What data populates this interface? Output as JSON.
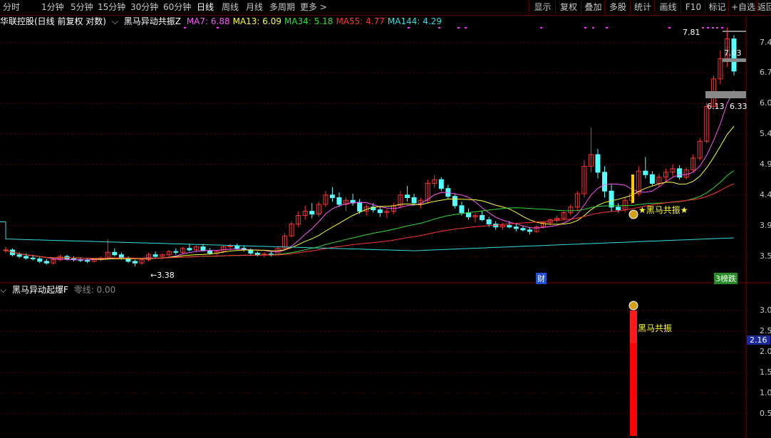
{
  "toolbar": {
    "periods": [
      "分时",
      "1分钟",
      "5分钟",
      "15分钟",
      "30分钟",
      "60分钟",
      "日线",
      "周线",
      "月线",
      "多周期",
      "更多"
    ],
    "active_period": "日线",
    "buttons": [
      "显示",
      "复权",
      "叠加",
      "多股",
      "统计",
      "画线",
      "F10",
      "标记",
      "+自选",
      "返回"
    ]
  },
  "upper_legend": {
    "stock": "华联控股(日线 前复权 对数)",
    "indicator": "黑马异动共振Z",
    "mas": [
      {
        "label": "MA7: 6.88",
        "color": "#ff55ff"
      },
      {
        "label": "MA13: 6.09",
        "color": "#ffff33"
      },
      {
        "label": "MA34: 5.18",
        "color": "#33dd33"
      },
      {
        "label": "MA55: 4.77",
        "color": "#ff3333"
      },
      {
        "label": "MA144: 4.29",
        "color": "#33dddd"
      }
    ]
  },
  "lower_legend": {
    "indicator": "黑马异动起爆F",
    "zero_line": "零线: 0.00"
  },
  "annotations": {
    "high": "7.81",
    "low": "←3.38",
    "price_7_03": "7.03",
    "price_6_13": "6.13",
    "price_6_33": "6.33",
    "signal_upper": "★黑马共振★",
    "signal_lower": "黑马共振",
    "cai": "财",
    "tag_right": "3榜跌"
  },
  "upper_axis": [
    "7.4",
    "6.7",
    "6.0",
    "5.4",
    "4.9",
    "4.4",
    "3.9",
    "3.5"
  ],
  "lower_axis": [
    "3.0",
    "2.5",
    "2.0",
    "1.5",
    "1.0",
    "0.5"
  ],
  "lower_value_tag": "2.16",
  "colors": {
    "up": "#ff3232",
    "down": "#54ffff",
    "grid": "#5a0000",
    "ma7": "#ff55ff",
    "ma13": "#ffff33",
    "ma34": "#33dd33",
    "ma55": "#ff3333",
    "ma144": "#33dddd"
  },
  "chart_data": {
    "type": "candlestick",
    "scale": "log",
    "y_ticks": [
      7.4,
      6.7,
      6.0,
      5.4,
      4.9,
      4.4,
      3.9,
      3.5
    ],
    "ohlc": [
      [
        3.58,
        3.62,
        3.54,
        3.58
      ],
      [
        3.58,
        3.6,
        3.5,
        3.52
      ],
      [
        3.52,
        3.55,
        3.48,
        3.5
      ],
      [
        3.5,
        3.54,
        3.46,
        3.48
      ],
      [
        3.48,
        3.52,
        3.45,
        3.47
      ],
      [
        3.47,
        3.5,
        3.42,
        3.44
      ],
      [
        3.44,
        3.47,
        3.4,
        3.42
      ],
      [
        3.42,
        3.48,
        3.4,
        3.46
      ],
      [
        3.46,
        3.52,
        3.44,
        3.5
      ],
      [
        3.5,
        3.52,
        3.45,
        3.47
      ],
      [
        3.47,
        3.5,
        3.44,
        3.46
      ],
      [
        3.46,
        3.49,
        3.43,
        3.45
      ],
      [
        3.45,
        3.48,
        3.42,
        3.44
      ],
      [
        3.44,
        3.47,
        3.42,
        3.46
      ],
      [
        3.46,
        3.5,
        3.44,
        3.48
      ],
      [
        3.48,
        3.72,
        3.46,
        3.55
      ],
      [
        3.55,
        3.6,
        3.5,
        3.52
      ],
      [
        3.52,
        3.55,
        3.46,
        3.48
      ],
      [
        3.48,
        3.5,
        3.42,
        3.44
      ],
      [
        3.44,
        3.46,
        3.38,
        3.42
      ],
      [
        3.42,
        3.48,
        3.4,
        3.46
      ],
      [
        3.46,
        3.55,
        3.44,
        3.52
      ],
      [
        3.52,
        3.56,
        3.48,
        3.5
      ],
      [
        3.5,
        3.54,
        3.47,
        3.52
      ],
      [
        3.52,
        3.58,
        3.5,
        3.56
      ],
      [
        3.56,
        3.6,
        3.52,
        3.55
      ],
      [
        3.55,
        3.62,
        3.53,
        3.6
      ],
      [
        3.6,
        3.66,
        3.56,
        3.58
      ],
      [
        3.58,
        3.64,
        3.55,
        3.62
      ],
      [
        3.62,
        3.66,
        3.56,
        3.57
      ],
      [
        3.57,
        3.6,
        3.52,
        3.54
      ],
      [
        3.54,
        3.58,
        3.51,
        3.56
      ],
      [
        3.56,
        3.64,
        3.54,
        3.62
      ],
      [
        3.62,
        3.66,
        3.58,
        3.63
      ],
      [
        3.63,
        3.66,
        3.58,
        3.6
      ],
      [
        3.6,
        3.64,
        3.56,
        3.58
      ],
      [
        3.58,
        3.6,
        3.52,
        3.54
      ],
      [
        3.54,
        3.56,
        3.5,
        3.52
      ],
      [
        3.52,
        3.55,
        3.49,
        3.53
      ],
      [
        3.53,
        3.56,
        3.5,
        3.52
      ],
      [
        3.52,
        3.62,
        3.51,
        3.6
      ],
      [
        3.6,
        3.8,
        3.58,
        3.76
      ],
      [
        3.76,
        3.96,
        3.74,
        3.92
      ],
      [
        3.92,
        4.1,
        3.88,
        4.04
      ],
      [
        4.04,
        4.18,
        3.98,
        4.1
      ],
      [
        4.1,
        4.22,
        4.0,
        4.06
      ],
      [
        4.06,
        4.24,
        4.02,
        4.2
      ],
      [
        4.2,
        4.4,
        4.16,
        4.34
      ],
      [
        4.34,
        4.46,
        4.24,
        4.3
      ],
      [
        4.3,
        4.38,
        4.16,
        4.2
      ],
      [
        4.2,
        4.3,
        4.1,
        4.26
      ],
      [
        4.26,
        4.36,
        4.18,
        4.22
      ],
      [
        4.22,
        4.28,
        4.06,
        4.1
      ],
      [
        4.1,
        4.2,
        4.04,
        4.16
      ],
      [
        4.16,
        4.22,
        4.08,
        4.12
      ],
      [
        4.12,
        4.18,
        4.02,
        4.08
      ],
      [
        4.08,
        4.14,
        4.0,
        4.1
      ],
      [
        4.1,
        4.22,
        4.06,
        4.18
      ],
      [
        4.18,
        4.4,
        4.14,
        4.34
      ],
      [
        4.34,
        4.48,
        4.24,
        4.3
      ],
      [
        4.3,
        4.36,
        4.18,
        4.22
      ],
      [
        4.22,
        4.3,
        4.14,
        4.26
      ],
      [
        4.26,
        4.58,
        4.22,
        4.52
      ],
      [
        4.52,
        4.66,
        4.46,
        4.58
      ],
      [
        4.58,
        4.62,
        4.4,
        4.44
      ],
      [
        4.44,
        4.5,
        4.28,
        4.32
      ],
      [
        4.32,
        4.36,
        4.14,
        4.18
      ],
      [
        4.18,
        4.24,
        4.04,
        4.08
      ],
      [
        4.08,
        4.14,
        3.98,
        4.02
      ],
      [
        4.02,
        4.08,
        3.94,
        4.04
      ],
      [
        4.04,
        4.1,
        3.96,
        3.98
      ],
      [
        3.98,
        4.02,
        3.88,
        3.92
      ],
      [
        3.92,
        3.96,
        3.84,
        3.88
      ],
      [
        3.88,
        3.94,
        3.84,
        3.9
      ],
      [
        3.9,
        3.96,
        3.86,
        3.88
      ],
      [
        3.88,
        3.92,
        3.82,
        3.86
      ],
      [
        3.86,
        3.9,
        3.82,
        3.84
      ],
      [
        3.84,
        3.88,
        3.78,
        3.82
      ],
      [
        3.82,
        3.9,
        3.8,
        3.88
      ],
      [
        3.88,
        3.96,
        3.86,
        3.94
      ],
      [
        3.94,
        4.0,
        3.9,
        3.98
      ],
      [
        3.98,
        4.04,
        3.94,
        4.0
      ],
      [
        4.0,
        4.1,
        3.98,
        4.08
      ],
      [
        4.08,
        4.2,
        4.04,
        4.16
      ],
      [
        4.16,
        4.4,
        4.1,
        4.36
      ],
      [
        4.36,
        4.9,
        4.3,
        4.8
      ],
      [
        4.8,
        5.5,
        4.7,
        5.0
      ],
      [
        5.0,
        5.1,
        4.6,
        4.7
      ],
      [
        4.7,
        4.8,
        4.3,
        4.4
      ],
      [
        4.4,
        4.5,
        4.1,
        4.16
      ],
      [
        4.16,
        4.22,
        4.08,
        4.12
      ],
      [
        4.12,
        4.3,
        4.08,
        4.26
      ],
      [
        4.26,
        4.4,
        4.2,
        4.36
      ],
      [
        4.36,
        4.8,
        4.32,
        4.72
      ],
      [
        4.72,
        4.96,
        4.6,
        4.66
      ],
      [
        4.66,
        4.72,
        4.48,
        4.52
      ],
      [
        4.52,
        4.68,
        4.46,
        4.62
      ],
      [
        4.62,
        4.76,
        4.54,
        4.7
      ],
      [
        4.7,
        4.84,
        4.62,
        4.76
      ],
      [
        4.76,
        4.82,
        4.58,
        4.62
      ],
      [
        4.62,
        4.78,
        4.58,
        4.74
      ],
      [
        4.74,
        5.0,
        4.7,
        4.94
      ],
      [
        4.94,
        5.3,
        4.9,
        5.24
      ],
      [
        5.24,
        6.0,
        5.2,
        5.92
      ],
      [
        5.92,
        6.6,
        5.86,
        6.52
      ],
      [
        6.52,
        7.2,
        6.4,
        7.0
      ],
      [
        7.0,
        7.81,
        6.8,
        7.5
      ],
      [
        7.5,
        7.6,
        6.6,
        6.7
      ]
    ],
    "low_label": 3.38,
    "high_label": 7.81,
    "lower_indicator": {
      "type": "bar",
      "value_peak": 3.1,
      "value_fill": 2.16,
      "y_ticks": [
        3.0,
        2.5,
        2.0,
        1.5,
        1.0,
        0.5
      ]
    }
  }
}
